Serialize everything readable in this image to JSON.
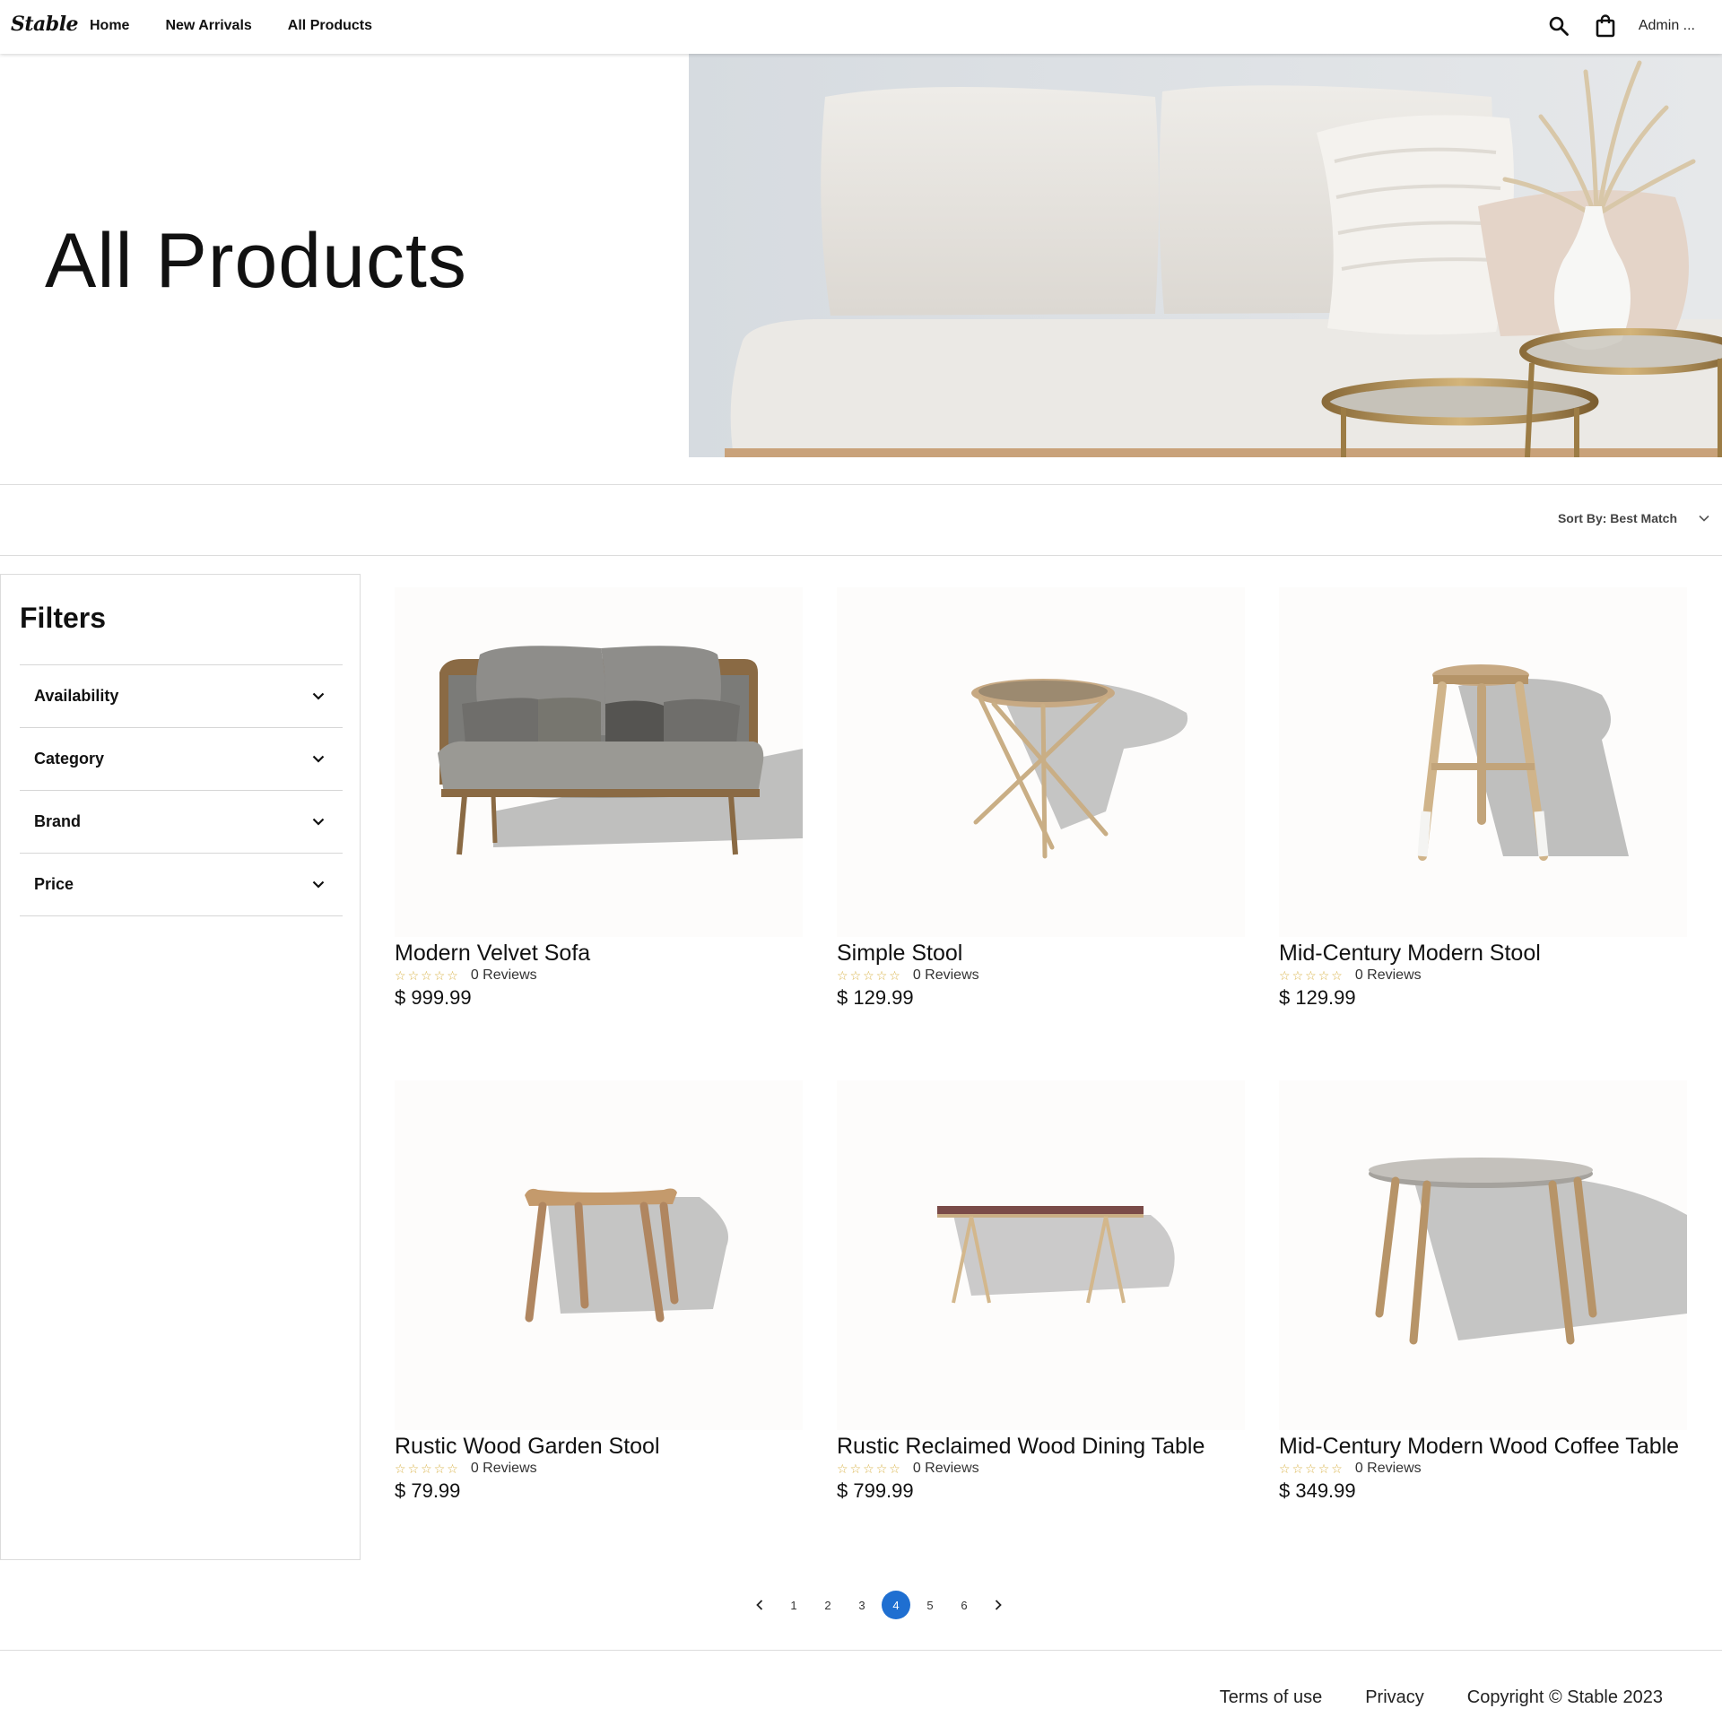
{
  "header": {
    "logo": "Stable",
    "nav": [
      {
        "label": "Home"
      },
      {
        "label": "New Arrivals"
      },
      {
        "label": "All Products"
      }
    ],
    "user": "Admin ...",
    "icons": [
      "search-icon",
      "shopping-bag-icon"
    ]
  },
  "hero": {
    "title": "All Products"
  },
  "sort": {
    "label": "Sort By: Best Match"
  },
  "filters": {
    "title": "Filters",
    "items": [
      {
        "label": "Availability"
      },
      {
        "label": "Category"
      },
      {
        "label": "Brand"
      },
      {
        "label": "Price"
      }
    ]
  },
  "products": [
    {
      "name": "Modern Velvet Sofa",
      "reviews": "0 Reviews",
      "price": "$ 999.99",
      "rating": 0
    },
    {
      "name": "Simple Stool",
      "reviews": "0 Reviews",
      "price": "$ 129.99",
      "rating": 0
    },
    {
      "name": "Mid-Century Modern Stool",
      "reviews": "0 Reviews",
      "price": "$ 129.99",
      "rating": 0
    },
    {
      "name": "Rustic Wood Garden Stool",
      "reviews": "0 Reviews",
      "price": "$ 79.99",
      "rating": 0
    },
    {
      "name": "Rustic Reclaimed Wood Dining Table",
      "reviews": "0 Reviews",
      "price": "$ 799.99",
      "rating": 0
    },
    {
      "name": "Mid-Century Modern Wood Coffee Table",
      "reviews": "0 Reviews",
      "price": "$ 349.99",
      "rating": 0
    }
  ],
  "pagination": {
    "pages": [
      "1",
      "2",
      "3",
      "4",
      "5",
      "6"
    ],
    "current": "4"
  },
  "footer": {
    "terms": "Terms of use",
    "privacy": "Privacy",
    "copyright": "Copyright © Stable 2023"
  },
  "colors": {
    "accent": "#1f6fd1",
    "star": "#d9b34a",
    "border": "#dcdcdc"
  }
}
